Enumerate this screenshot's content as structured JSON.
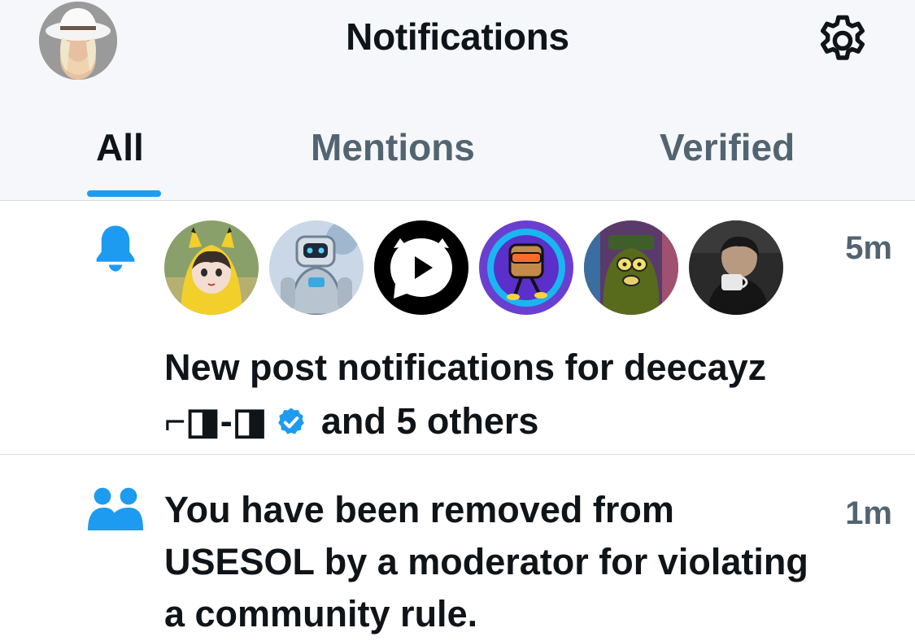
{
  "header": {
    "title": "Notifications",
    "settings_icon": "gear-icon"
  },
  "tabs": [
    {
      "label": "All",
      "active": true
    },
    {
      "label": "Mentions",
      "active": false
    },
    {
      "label": "Verified",
      "active": false
    }
  ],
  "notifications": [
    {
      "icon": "bell-icon",
      "time": "5m",
      "text_line1": "New post notifications for deecayz",
      "name_symbols": "⌐◨-◨",
      "text_line2_suffix": "and 5 others",
      "verified": true,
      "avatar_count": 6
    },
    {
      "icon": "people-icon",
      "time": "1m",
      "text": "You have been removed from USESOL by a moderator for violating a community rule."
    }
  ],
  "colors": {
    "accent": "#1d9bf0",
    "text_primary": "#0f1419",
    "text_secondary": "#536471",
    "header_bg": "#f5f7fa",
    "divider": "#d6dbe0"
  }
}
